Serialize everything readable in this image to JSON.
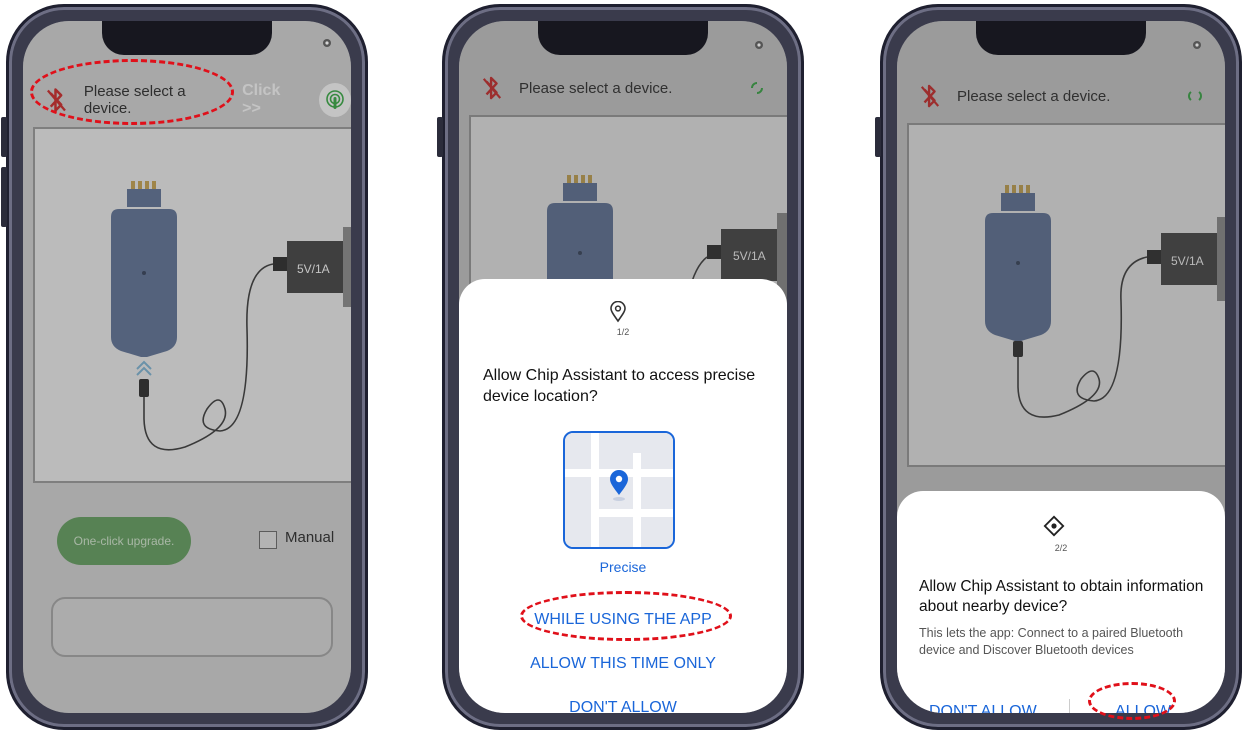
{
  "phone1": {
    "status": "Please select a device.",
    "click_hint": "Click >>",
    "charger_label": "5V/1A",
    "upgrade_button": "One-click upgrade.",
    "manual_label": "Manual"
  },
  "phone2": {
    "status": "Please select a device.",
    "charger_label": "5V/1A",
    "dialog": {
      "step": "1/2",
      "title": "Allow Chip Assistant to access precise device location?",
      "map_label": "Precise",
      "while_using": "WHILE USING THE APP",
      "this_time": "ALLOW THIS TIME ONLY",
      "deny": "DON'T ALLOW"
    }
  },
  "phone3": {
    "status": "Please select a device.",
    "charger_label": "5V/1A",
    "dialog": {
      "step": "2/2",
      "title": "Allow Chip Assistant to obtain information about nearby device?",
      "body": "This lets the app: Connect to a paired Bluetooth device and Discover Bluetooth devices",
      "deny": "DON'T ALLOW",
      "allow": "ALLOW"
    }
  },
  "colors": {
    "highlight_ring": "#e0101a",
    "link_blue": "#1a66d9",
    "status_icon": "#d12020",
    "spinner": "#2eaa3c",
    "upgrade_green": "#5f9e5a",
    "device_blue": "#5a6f96"
  },
  "icons": [
    "bluetooth-off-icon",
    "gear-icon",
    "touch-icon",
    "location-pin-icon",
    "nearby-device-icon",
    "loading-spinner-icon",
    "usb-arrows-icon"
  ]
}
